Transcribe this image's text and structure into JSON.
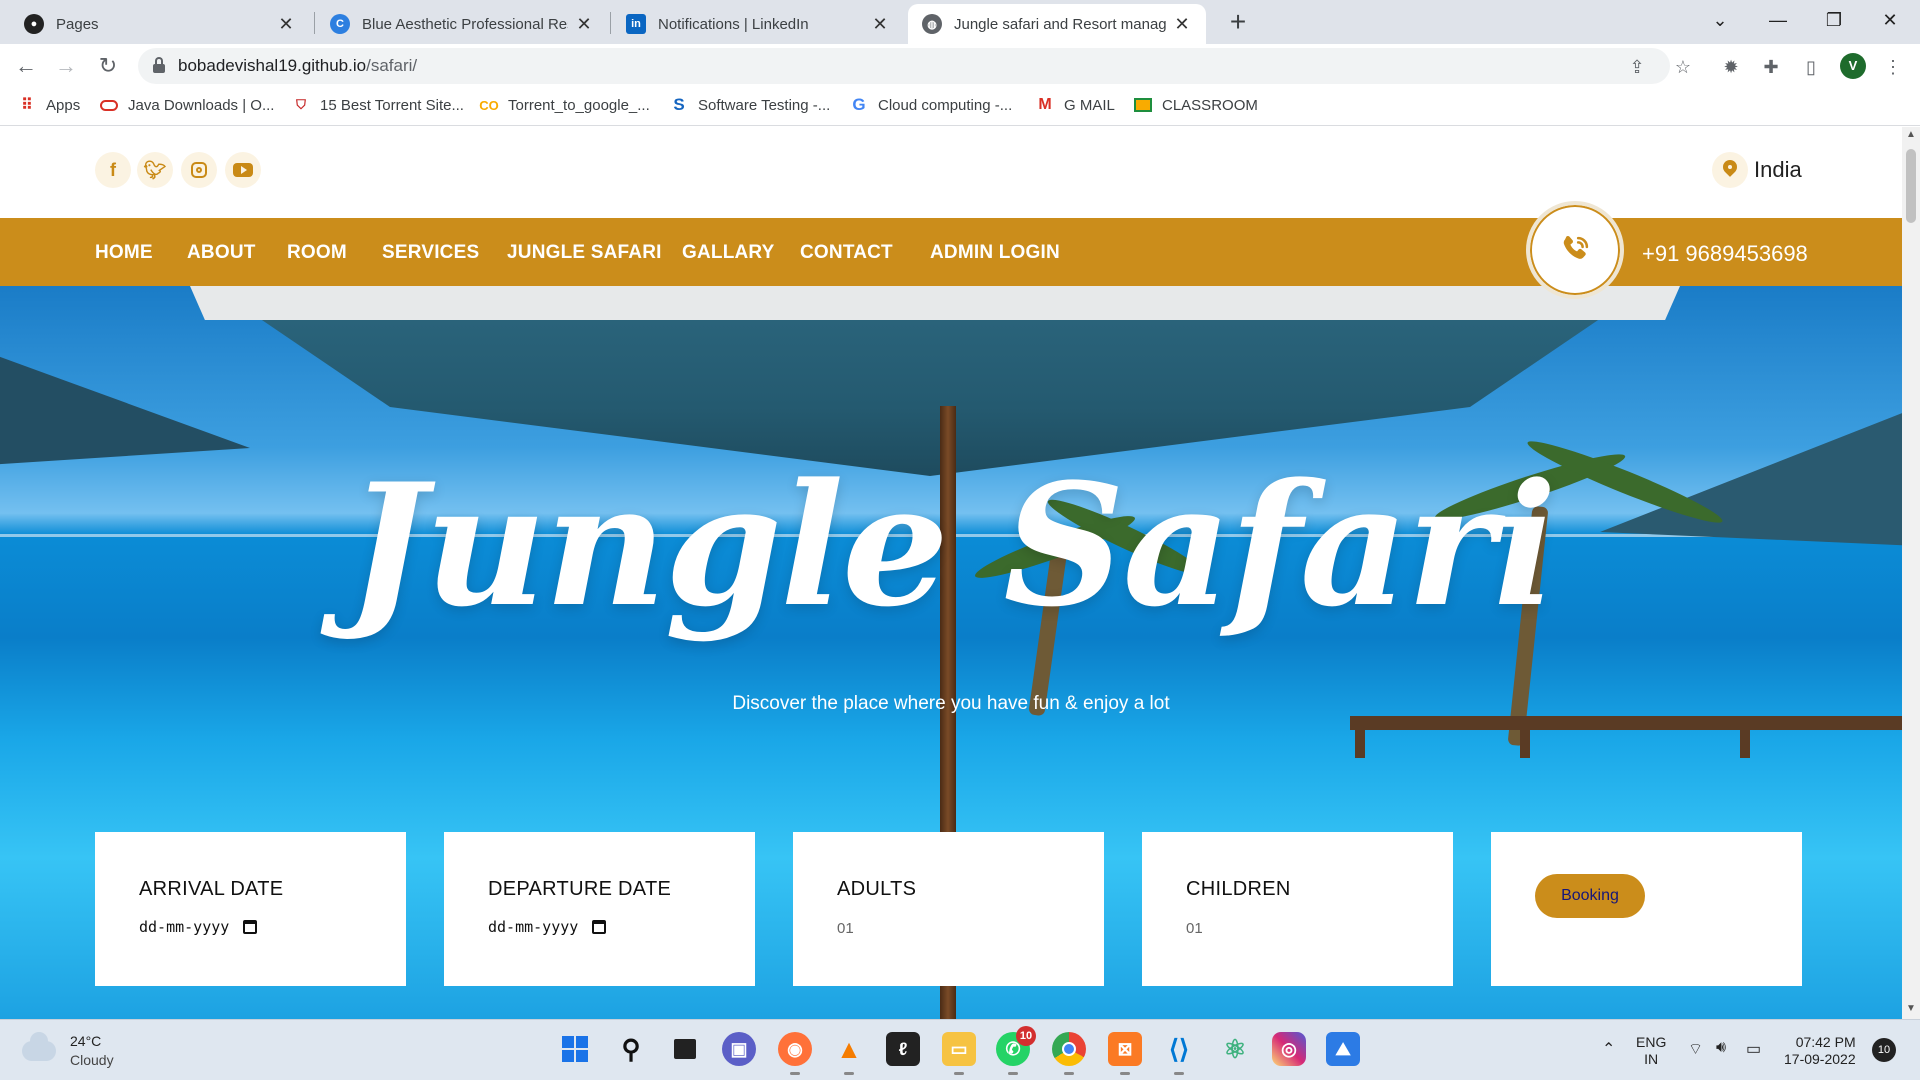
{
  "browser": {
    "tabs": [
      {
        "label": "Pages",
        "icon": "github-icon"
      },
      {
        "label": "Blue Aesthetic Professional Resum",
        "icon": "canva-icon"
      },
      {
        "label": "Notifications | LinkedIn",
        "icon": "linkedin-icon"
      },
      {
        "label": "Jungle safari and Resort manager",
        "icon": "globe-icon"
      }
    ],
    "url_domain": "bobadevishal19.github.io",
    "url_path": "/safari/",
    "profile_initial": "V",
    "bookmarks": [
      {
        "label": "Apps",
        "icon": "apps-grid-icon"
      },
      {
        "label": "Java Downloads | O...",
        "icon": "oracle-icon"
      },
      {
        "label": "15 Best Torrent Site...",
        "icon": "shield-icon"
      },
      {
        "label": "Torrent_to_google_...",
        "icon": "colab-icon"
      },
      {
        "label": "Software Testing -...",
        "icon": "s-icon"
      },
      {
        "label": "Cloud computing -...",
        "icon": "google-icon"
      },
      {
        "label": "G MAIL",
        "icon": "gmail-icon"
      },
      {
        "label": "CLASSROOM",
        "icon": "classroom-icon"
      }
    ]
  },
  "site": {
    "location": "India",
    "nav": [
      "HOME",
      "ABOUT",
      "ROOM",
      "SERVICES",
      "JUNGLE SAFARI",
      "GALLARY",
      "CONTACT",
      "ADMIN LOGIN"
    ],
    "phone": "+91 9689453698",
    "hero_title": "Jungle Safari",
    "hero_subtitle": "Discover the place where you have fun & enjoy a lot",
    "booking": {
      "arrival_label": "ARRIVAL DATE",
      "arrival_value": "dd-mm-yyyy",
      "departure_label": "DEPARTURE DATE",
      "departure_value": "dd-mm-yyyy",
      "adults_label": "ADULTS",
      "adults_value": "01",
      "children_label": "CHILDREN",
      "children_value": "01",
      "button": "Booking"
    },
    "colors": {
      "accent": "#cb8d1b",
      "button_text": "#15167a"
    }
  },
  "taskbar": {
    "weather_temp": "24°C",
    "weather_cond": "Cloudy",
    "whatsapp_badge": "10",
    "lang_1": "ENG",
    "lang_2": "IN",
    "time": "07:42 PM",
    "date": "17-09-2022",
    "notifications": "10"
  }
}
